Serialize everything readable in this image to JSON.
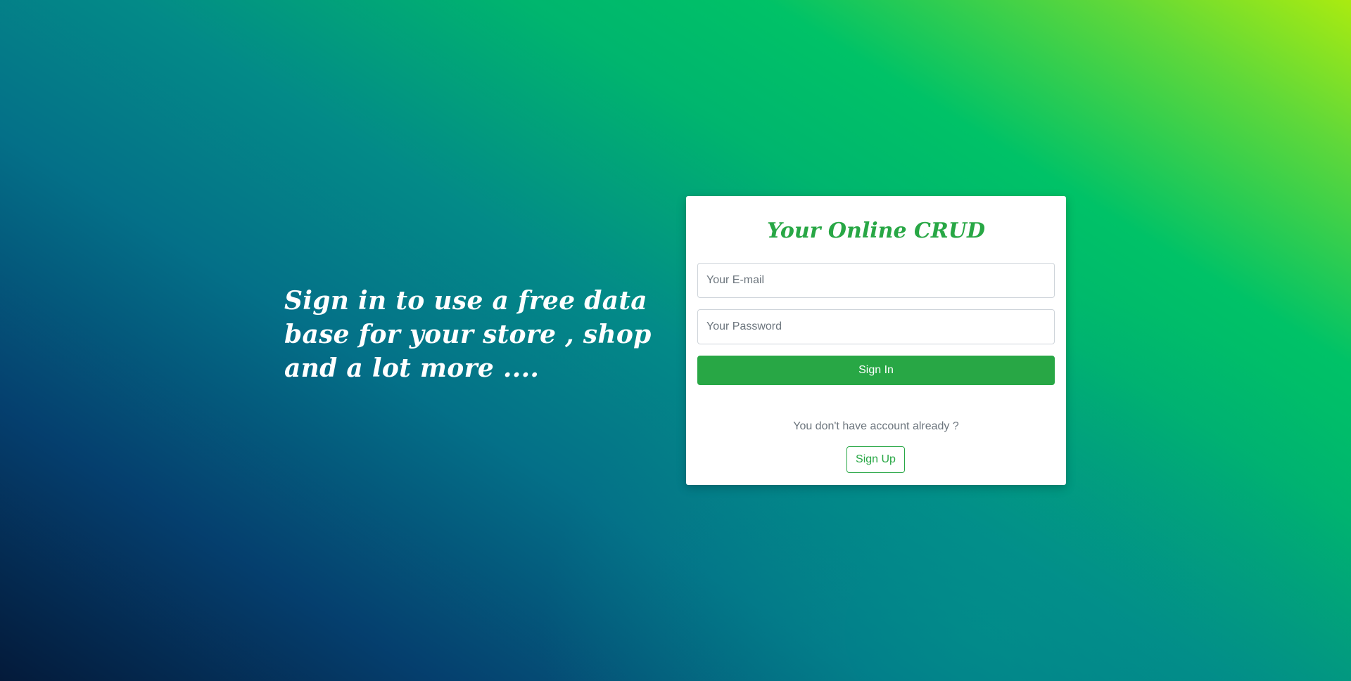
{
  "hero": {
    "tagline": "Sign in to use a free data base for your store , shop and a lot more ...."
  },
  "login_card": {
    "title": "Your Online CRUD",
    "email_placeholder": "Your E-mail",
    "password_placeholder": "Your Password",
    "signin_label": "Sign In",
    "signup_prompt": "You don't have account already ?",
    "signup_label": "Sign Up"
  },
  "colors": {
    "accent": "#28a745",
    "background_dark": "#041a3a",
    "background_light": "#aaeb10"
  }
}
